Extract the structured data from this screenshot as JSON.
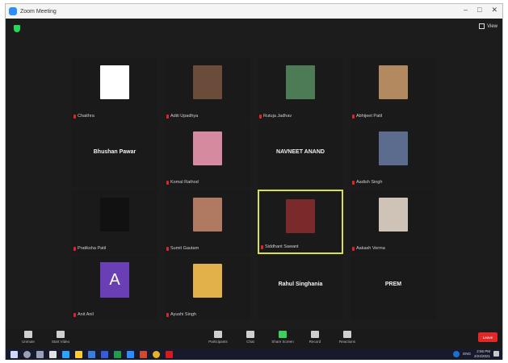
{
  "window": {
    "title": "Zoom Meeting",
    "view_label": "View"
  },
  "tiles": [
    {
      "name": "Chaithra",
      "type": "photo",
      "color": "#ffffff"
    },
    {
      "name": "Aditi Upadhya",
      "type": "photo",
      "color": "#6b4b3a"
    },
    {
      "name": "Rutuja Jadhav",
      "type": "photo",
      "color": "#4c7b55"
    },
    {
      "name": "Abhijeet Patil",
      "type": "photo",
      "color": "#b38960"
    },
    {
      "name": "Bhushan Pawar",
      "type": "text"
    },
    {
      "name": "Komal Rathod",
      "type": "photo",
      "color": "#d58aa0"
    },
    {
      "name": "NAVNEET ANAND",
      "type": "text"
    },
    {
      "name": "Aadish Singh",
      "type": "photo",
      "color": "#5c6c8f"
    },
    {
      "name": "Pratiksha Patil",
      "type": "photo",
      "color": "#111111"
    },
    {
      "name": "Sumit Gautam",
      "type": "photo",
      "color": "#b07a62"
    },
    {
      "name": "Siddhant Sawant",
      "type": "photo",
      "color": "#7a2a2a",
      "active": true
    },
    {
      "name": "Aakash Verma",
      "type": "photo",
      "color": "#cfc2b6"
    },
    {
      "name": "Anit Anil",
      "type": "letter",
      "letter": "A"
    },
    {
      "name": "Ayushi Singh",
      "type": "photo",
      "color": "#e3b14a"
    },
    {
      "name": "Rahul Singhania",
      "type": "text"
    },
    {
      "name": "PREM",
      "type": "text"
    }
  ],
  "toolbar": {
    "unmute": "Unmute",
    "start_video": "Start Video",
    "participants": "Participants",
    "participants_count": "16",
    "chat": "Chat",
    "share_screen": "Share Screen",
    "record": "Record",
    "reactions": "Reactions",
    "leave": "Leave"
  },
  "taskbar": {
    "time": "2:56 PM",
    "date": "2/24/2021",
    "lang": "ENG"
  }
}
